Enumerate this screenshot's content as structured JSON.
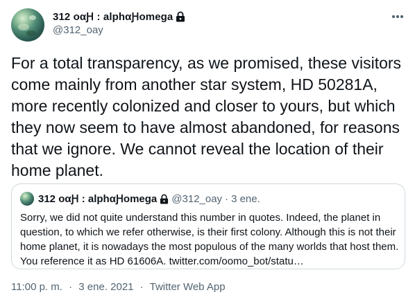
{
  "author": {
    "display_name": "312 οαԨ : alphαԨomega",
    "handle": "@312_oay",
    "lock_icon": "lock-icon",
    "more_icon": "more-horizontal-icon"
  },
  "tweet": {
    "text": "For a total transparency, as we promised, these visitors\ncome mainly from another star system, HD 50281A,\nmore recently colonized and closer to yours, but which\nthey now seem to have almost abandoned, for reasons\nthat we ignore. We cannot reveal the location of their\nhome planet."
  },
  "quoted_tweet": {
    "display_name": "312 οαԨ : alphαԨomega",
    "handle": "@312_oay",
    "separator": "·",
    "date": "3 ene.",
    "text": "Sorry, we did not quite understand this number in quotes. Indeed, the planet in\nquestion, to which we refer otherwise, is their first colony. Although this is not their\nhome planet, it is nowadays the most populous of the many worlds that host them.\nYou reference it as HD 61606A. twitter.com/oomo_bot/statu…"
  },
  "meta": {
    "time": "11:00 p. m.",
    "separator": "·",
    "date": "3 ene. 2021",
    "source": "Twitter Web App"
  },
  "colors": {
    "text_primary": "#0f1419",
    "text_secondary": "#536471",
    "border": "#cfd9de"
  }
}
